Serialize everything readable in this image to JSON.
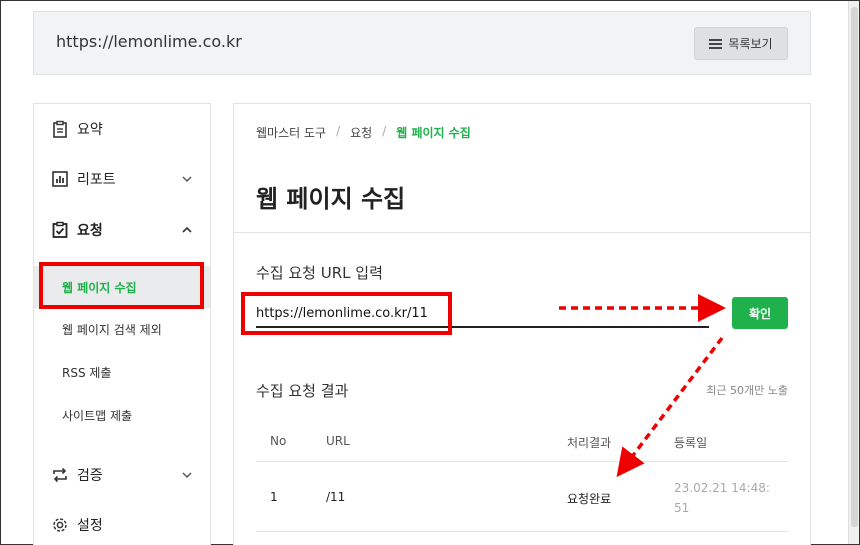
{
  "header": {
    "site_url": "https://lemonlime.co.kr",
    "list_button_label": "목록보기"
  },
  "sidebar": {
    "items": [
      {
        "label": "요약",
        "icon": "clipboard-icon"
      },
      {
        "label": "리포트",
        "icon": "bar-chart-icon"
      },
      {
        "label": "요청",
        "icon": "checklist-icon"
      },
      {
        "label": "검증",
        "icon": "repeat-icon"
      },
      {
        "label": "설정",
        "icon": "gear-icon"
      }
    ],
    "sub_items": [
      {
        "label": "웹 페이지 수집",
        "active": true
      },
      {
        "label": "웹 페이지 검색 제외"
      },
      {
        "label": "RSS 제출"
      },
      {
        "label": "사이트맵 제출"
      }
    ]
  },
  "main": {
    "breadcrumb": [
      "웹마스터 도구",
      "요청",
      "웹 페이지 수집"
    ],
    "title": "웹 페이지 수집",
    "url_section_label": "수집 요청 URL 입력",
    "url_input_value": "https://lemonlime.co.kr/11",
    "confirm_label": "확인",
    "result_section_label": "수집 요청 결과",
    "result_note": "최근 50개만 노출",
    "table": {
      "headers": [
        "No",
        "URL",
        "처리결과",
        "등록일"
      ],
      "rows": [
        {
          "no": "1",
          "url": "/11",
          "status": "요청완료",
          "date_line1": "23.02.21 14:48:",
          "date_line2": "51"
        }
      ]
    }
  },
  "colors": {
    "accent": "#1fb14b",
    "highlight": "#ee0000"
  }
}
